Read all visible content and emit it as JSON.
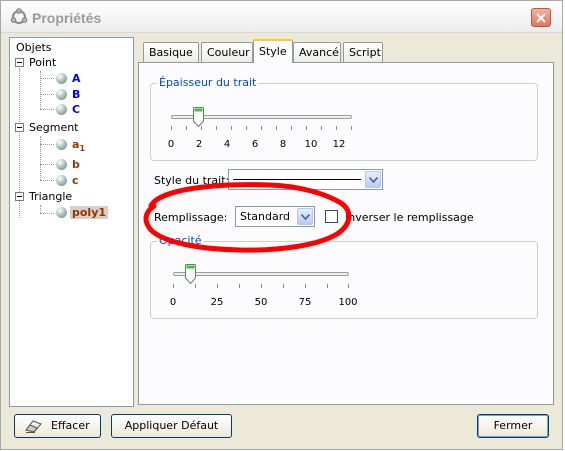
{
  "window": {
    "title": "Propriétés"
  },
  "tree": {
    "root": "Objets",
    "groups": [
      {
        "label": "Point",
        "items": [
          {
            "label": "A",
            "color": "#0000ff"
          },
          {
            "label": "B",
            "color": "#0000ff"
          },
          {
            "label": "C",
            "color": "#0000ff"
          }
        ]
      },
      {
        "label": "Segment",
        "items": [
          {
            "label": "a",
            "sub": "1",
            "color": "#993300"
          },
          {
            "label": "b",
            "color": "#993300"
          },
          {
            "label": "c",
            "color": "#993300"
          }
        ]
      },
      {
        "label": "Triangle",
        "items": [
          {
            "label": "poly1",
            "color": "#993300",
            "selected": true
          }
        ]
      }
    ]
  },
  "tabs": [
    {
      "label": "Basique"
    },
    {
      "label": "Couleur"
    },
    {
      "label": "Style",
      "active": true
    },
    {
      "label": "Avancé"
    },
    {
      "label": "Script"
    }
  ],
  "style_tab": {
    "thickness": {
      "title": "Épaisseur du trait",
      "value": 2,
      "min": 0,
      "max": 12,
      "tick_labels": [
        "0",
        "2",
        "4",
        "6",
        "8",
        "10",
        "12"
      ]
    },
    "line_style": {
      "label": "Style du trait:",
      "selected": "solid"
    },
    "fill": {
      "label": "Remplissage:",
      "selected": "Standard",
      "invert_label": "Inverser le remplissage",
      "invert_checked": false
    },
    "opacity": {
      "title": "Opacité",
      "value": 10,
      "min": 0,
      "max": 100,
      "tick_labels": [
        "0",
        "25",
        "50",
        "75",
        "100"
      ]
    }
  },
  "buttons": {
    "clear": "Effacer",
    "apply_default": "Appliquer Défaut",
    "close": "Fermer"
  },
  "annotation": {
    "color": "#ff0000",
    "shape": "hand-drawn-ellipse"
  },
  "colors": {
    "window_bg": "#ece9d8",
    "group_title": "#0046d5",
    "active_tab_accent": "#ffc83c"
  }
}
